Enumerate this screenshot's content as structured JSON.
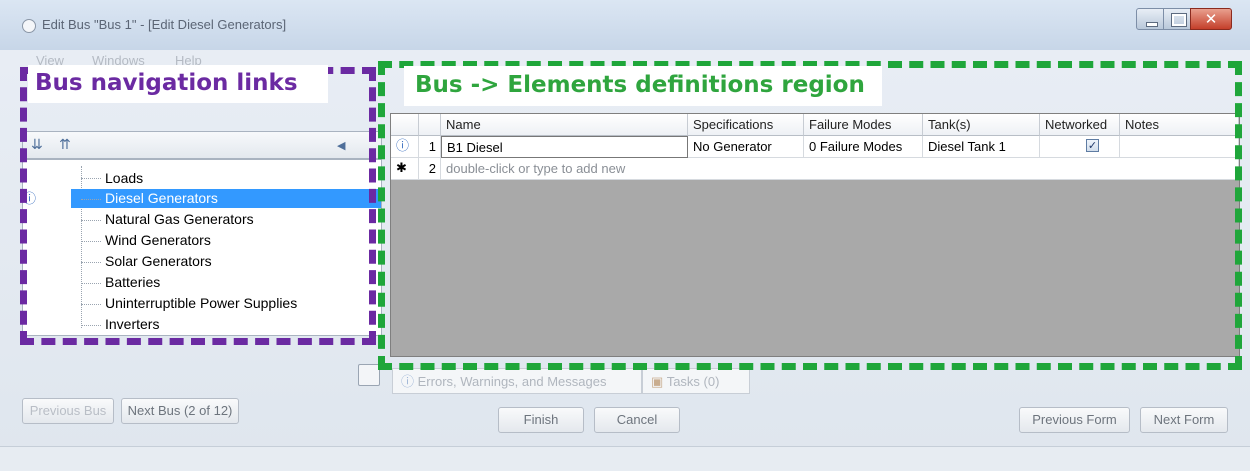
{
  "window": {
    "title": "Edit Bus \"Bus 1\" - [Edit Diesel Generators]",
    "close_glyph": "✕"
  },
  "menu": [
    "View",
    "Windows",
    "Help"
  ],
  "annotations": {
    "nav_label": "Bus navigation links",
    "elements_label": "Bus -> Elements definitions region",
    "nav_color": "#6b2aa2",
    "elements_color": "#1fa63a"
  },
  "nav": {
    "toolbar_icons": [
      "expand-all-icon",
      "collapse-all-icon",
      "arrow-left-icon"
    ],
    "items": [
      {
        "label": "Loads",
        "selected": false
      },
      {
        "label": "Diesel Generators",
        "selected": true
      },
      {
        "label": "Natural Gas Generators",
        "selected": false
      },
      {
        "label": "Wind Generators",
        "selected": false
      },
      {
        "label": "Solar Generators",
        "selected": false
      },
      {
        "label": "Batteries",
        "selected": false
      },
      {
        "label": "Uninterruptible Power Supplies",
        "selected": false
      },
      {
        "label": "Inverters",
        "selected": false
      }
    ]
  },
  "grid": {
    "columns": [
      "Name",
      "Specifications",
      "Failure Modes",
      "Tank(s)",
      "Networked",
      "Notes"
    ],
    "rows": [
      {
        "marker": "ⓘ",
        "num": "1",
        "name": "B1 Diesel",
        "specifications": "No Generator",
        "failure_modes": "0 Failure Modes",
        "tanks": "Diesel Tank 1",
        "networked": true,
        "notes": ""
      },
      {
        "marker": "✱",
        "num": "2",
        "name": "double-click or type to add new"
      }
    ],
    "check_glyph": "✓"
  },
  "status_tabs": {
    "errors": "Errors, Warnings, and Messages",
    "tasks": "Tasks (0)"
  },
  "buttons": {
    "previous_bus": "Previous Bus",
    "next_bus": "Next Bus (2 of 12)",
    "finish": "Finish",
    "cancel": "Cancel",
    "previous_form": "Previous Form",
    "next_form": "Next Form"
  }
}
